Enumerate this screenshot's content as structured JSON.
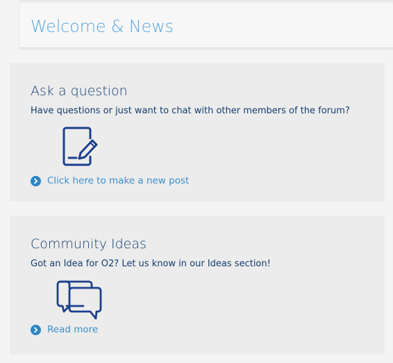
{
  "header": {
    "title": "Welcome & News"
  },
  "panels": [
    {
      "title": "Ask a question",
      "description": "Have questions or just want to chat with other members of the forum?",
      "icon": "new-post-icon",
      "link_text": "Click here to make a new post"
    },
    {
      "title": "Community Ideas",
      "description": "Got an Idea for O2? Let us know in our Ideas section!",
      "icon": "chat-bubbles-icon",
      "link_text": "Read more"
    }
  ],
  "colors": {
    "title_blue": "#5aa6de",
    "text_navy": "#143d6e",
    "link_blue": "#3d8fcc",
    "chevron_blue": "#2d86c5",
    "icon_navy": "#1c3f8c"
  }
}
